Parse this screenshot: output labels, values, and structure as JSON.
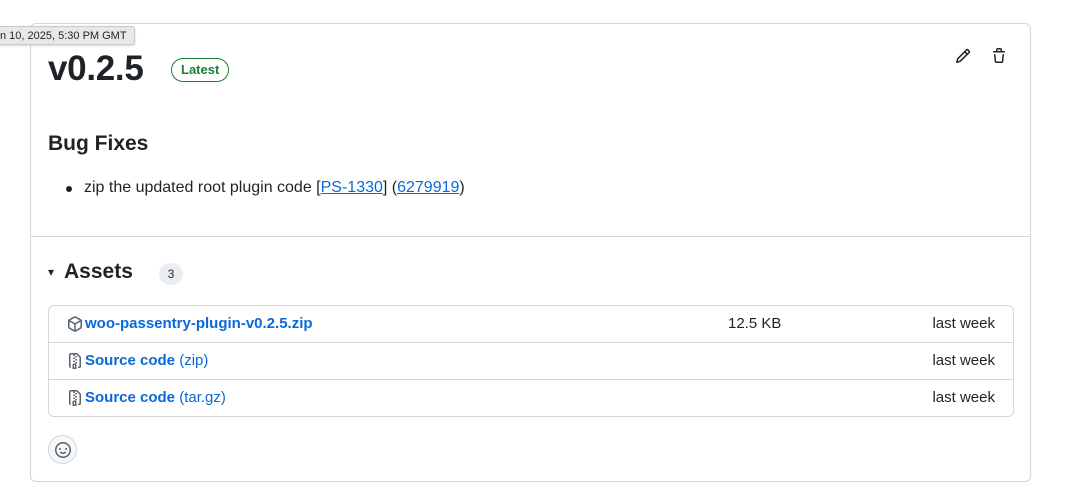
{
  "tooltip": {
    "text": "n 10, 2025, 5:30 PM GMT"
  },
  "release": {
    "title": "v0.2.5",
    "badge": "Latest"
  },
  "actions": {
    "edit_icon": "pencil-icon",
    "delete_icon": "trash-icon"
  },
  "notes": {
    "heading": "Bug Fixes",
    "items": [
      {
        "text_before": "zip the updated root plugin code [",
        "issue_link": "PS-1330",
        "text_middle": "] (",
        "commit_link": "6279919",
        "text_after": ")"
      }
    ]
  },
  "assets": {
    "caret": "▾",
    "title": "Assets",
    "count": "3",
    "rows": [
      {
        "icon": "package-icon",
        "name": "woo-passentry-plugin-v0.2.5.zip",
        "suffix": "",
        "size": "12.5 KB",
        "date": "last week"
      },
      {
        "icon": "file-zip-icon",
        "name": "Source code",
        "suffix": " (zip)",
        "size": "",
        "date": "last week"
      },
      {
        "icon": "file-zip-icon",
        "name": "Source code",
        "suffix": " (tar.gz)",
        "size": "",
        "date": "last week"
      }
    ]
  },
  "reactions": {
    "icon": "smiley-icon"
  },
  "colors": {
    "link": "#0969da",
    "badge_green": "#1a7f37",
    "border": "#d0d7de",
    "text": "#1f2328"
  }
}
